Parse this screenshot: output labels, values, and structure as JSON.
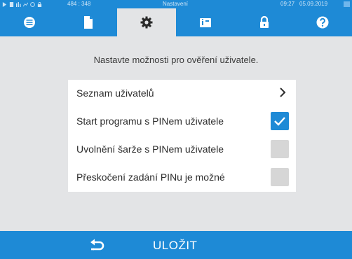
{
  "status": {
    "coords": "484 : 348",
    "title": "Nastavení",
    "time": "09:27",
    "date": "05.09.2019"
  },
  "tabs": [
    {
      "icon": "list-icon"
    },
    {
      "icon": "document-icon"
    },
    {
      "icon": "gear-icon",
      "active": true
    },
    {
      "icon": "device-info-icon"
    },
    {
      "icon": "lock-icon"
    },
    {
      "icon": "help-icon"
    }
  ],
  "main": {
    "prompt": "Nastavte možnosti pro ověření uživatele.",
    "options": [
      {
        "label": "Seznam uživatelů",
        "type": "link"
      },
      {
        "label": "Start programu s PINem uživatele",
        "checked": true
      },
      {
        "label": "Uvolnění šarže s PINem uživatele",
        "checked": false
      },
      {
        "label": "Přeskočení zadání PINu je možné",
        "checked": false
      }
    ]
  },
  "bottom": {
    "save_label": "ULOŽIT",
    "back_icon": "back-arrow-icon"
  },
  "colors": {
    "accent": "#1e8ad6",
    "background": "#e3e4e6"
  }
}
